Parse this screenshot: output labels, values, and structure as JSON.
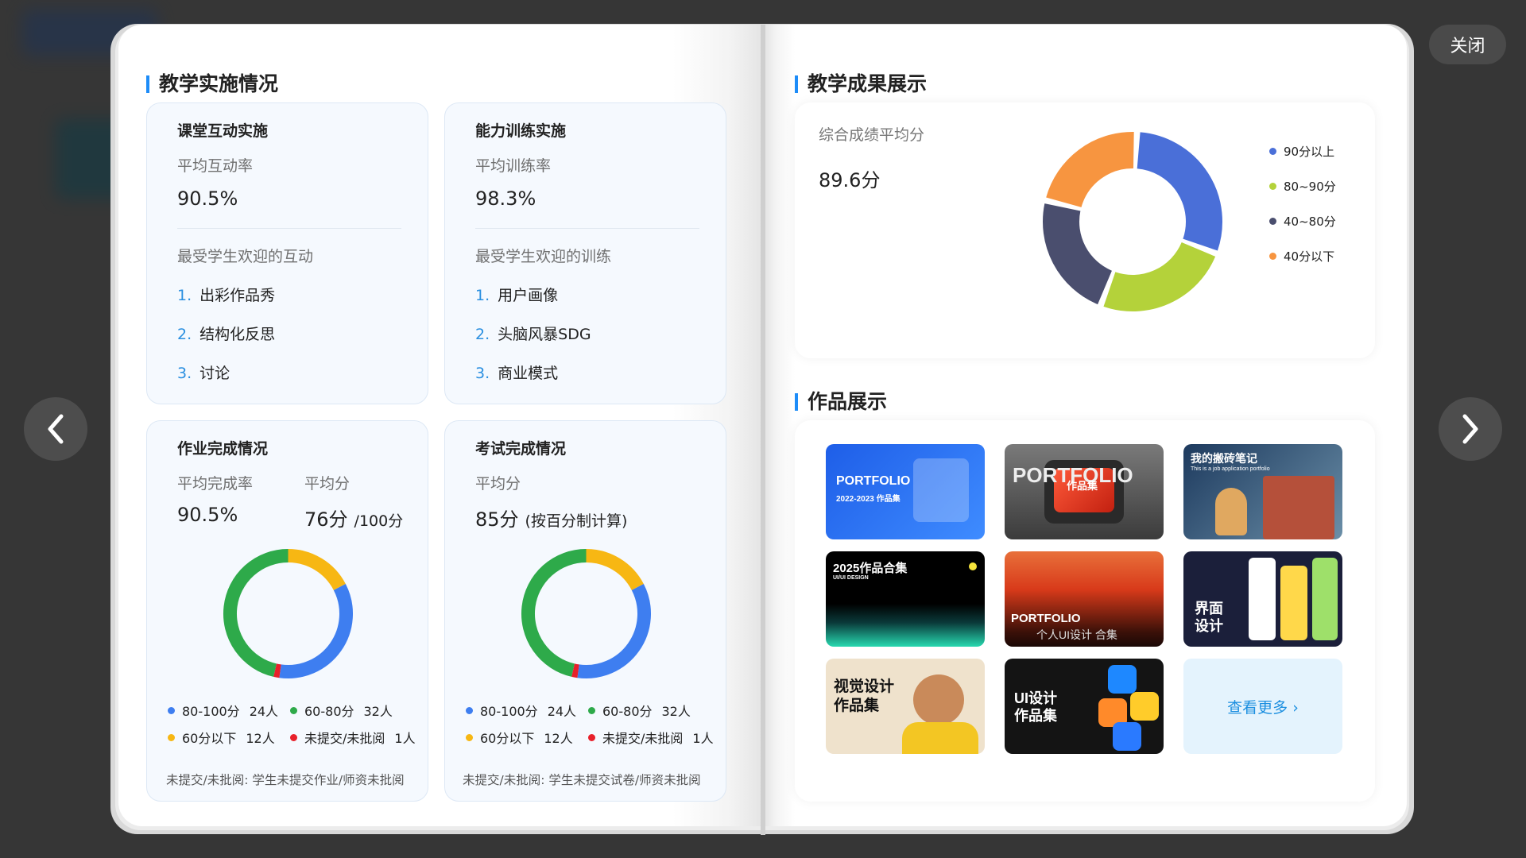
{
  "close_label": "关闭",
  "left_page": {
    "section_title": "教学实施情况",
    "classroom": {
      "title": "课堂互动实施",
      "metric_label": "平均互动率",
      "metric_value": "90.5%",
      "popular_label": "最受学生欢迎的互动",
      "items": [
        {
          "num": "1.",
          "text": "出彩作品秀"
        },
        {
          "num": "2.",
          "text": "结构化反思"
        },
        {
          "num": "3.",
          "text": "讨论"
        }
      ]
    },
    "training": {
      "title": "能力训练实施",
      "metric_label": "平均训练率",
      "metric_value": "98.3%",
      "popular_label": "最受学生欢迎的训练",
      "items": [
        {
          "num": "1.",
          "text": "用户画像"
        },
        {
          "num": "2.",
          "text": "头脑风暴SDG"
        },
        {
          "num": "3.",
          "text": "商业模式"
        }
      ]
    },
    "homework": {
      "title": "作业完成情况",
      "rate_label": "平均完成率",
      "rate_value": "90.5%",
      "score_label": "平均分",
      "score_value": "76分",
      "score_suffix": "/100分",
      "legend": [
        {
          "label": "80-100分",
          "count": "24人",
          "color": "#3e7ef0"
        },
        {
          "label": "60-80分",
          "count": "32人",
          "color": "#2eaa4a"
        },
        {
          "label": "60分以下",
          "count": "12人",
          "color": "#f7b713"
        },
        {
          "label": "未提交/未批阅",
          "count": "1人",
          "color": "#e8202a"
        }
      ],
      "footnote": "未提交/未批阅: 学生未提交作业/师资未批阅"
    },
    "exam": {
      "title": "考试完成情况",
      "score_label": "平均分",
      "score_value": "85分",
      "score_note": "(按百分制计算)",
      "legend": [
        {
          "label": "80-100分",
          "count": "24人",
          "color": "#3e7ef0"
        },
        {
          "label": "60-80分",
          "count": "32人",
          "color": "#2eaa4a"
        },
        {
          "label": "60分以下",
          "count": "12人",
          "color": "#f7b713"
        },
        {
          "label": "未提交/未批阅",
          "count": "1人",
          "color": "#e8202a"
        }
      ],
      "footnote": "未提交/未批阅: 学生未提交试卷/师资未批阅"
    }
  },
  "right_page": {
    "section_title": "教学成果展示",
    "score_label": "综合成绩平均分",
    "score_value": "89.6分",
    "legend": [
      {
        "label": "90分以上",
        "color": "#4a6fd8"
      },
      {
        "label": "80~90分",
        "color": "#b4d23a"
      },
      {
        "label": "40~80分",
        "color": "#4a4e6e"
      },
      {
        "label": "40分以下",
        "color": "#f79540"
      }
    ],
    "works_title": "作品展示",
    "thumbs": [
      {
        "line1": "PORTFOLIO",
        "line2": "2022-2023 作品集"
      },
      {
        "line1": "PORTFOLIO",
        "line2": "作品集"
      },
      {
        "line1": "我的搬砖笔记",
        "line2": "This is a job application portfolio"
      },
      {
        "line1": "2025作品合集",
        "line2": "UI/UI DESIGN"
      },
      {
        "line1": "PORTFOLIO",
        "line2": "个人UI设计 合集"
      },
      {
        "line1": "界面",
        "line2": "设计"
      },
      {
        "line1": "视觉设计",
        "line2": "作品集"
      },
      {
        "line1": "UI设计",
        "line2": "作品集"
      }
    ],
    "more_label": "查看更多 ›"
  },
  "chart_data": [
    {
      "type": "pie",
      "title": "作业完成情况",
      "categories": [
        "80-100分",
        "60-80分",
        "60分以下",
        "未提交/未批阅"
      ],
      "values": [
        24,
        32,
        12,
        1
      ],
      "colors": [
        "#3e7ef0",
        "#2eaa4a",
        "#f7b713",
        "#e8202a"
      ]
    },
    {
      "type": "pie",
      "title": "考试完成情况",
      "categories": [
        "80-100分",
        "60-80分",
        "60分以下",
        "未提交/未批阅"
      ],
      "values": [
        24,
        32,
        12,
        1
      ],
      "colors": [
        "#3e7ef0",
        "#2eaa4a",
        "#f7b713",
        "#e8202a"
      ]
    },
    {
      "type": "pie",
      "title": "综合成绩平均分",
      "categories": [
        "90分以上",
        "80~90分",
        "40~80分",
        "40分以下"
      ],
      "values": [
        30,
        25,
        23,
        22
      ],
      "colors": [
        "#4a6fd8",
        "#b4d23a",
        "#4a4e6e",
        "#f79540"
      ]
    }
  ]
}
